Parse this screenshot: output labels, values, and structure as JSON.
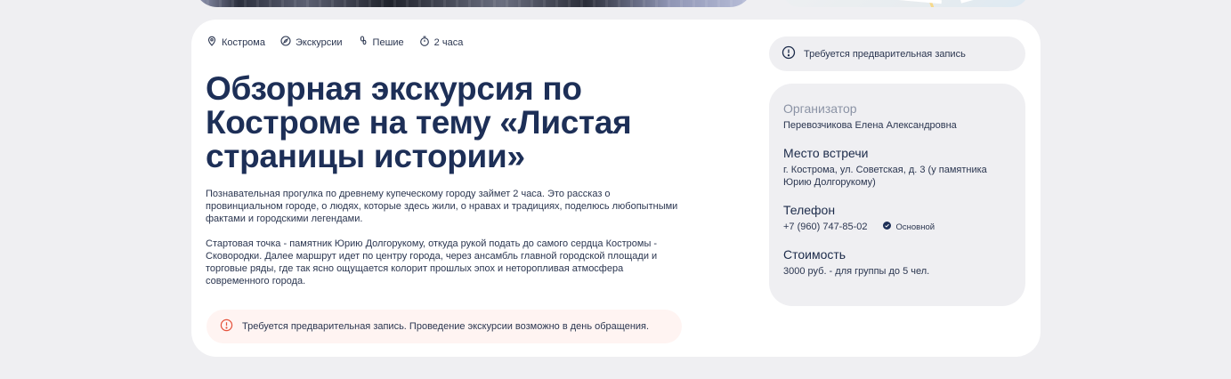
{
  "meta": {
    "city": "Кострома",
    "category": "Экскурсии",
    "mode": "Пешие",
    "duration": "2 часа"
  },
  "tour": {
    "title": "Обзорная экскурсия по Костроме на тему «Листая страницы истории»",
    "description": [
      "Познавательная прогулка по древнему купеческому городу займет 2 часа. Это рассказ о провинциальном городе, о людях, которые здесь жили, о нравах и традициях, поделюсь любопытными фактами и городскими легендами.",
      "Стартовая точка - памятник Юрию Долгорукому, откуда рукой подать до самого сердца Костромы - Сковородки. Далее маршрут идет по центру города, через ансамбль главной городской площади и торговые ряды, где так ясно ощущается колорит прошлых эпох и неторопливая атмосфера современного города."
    ],
    "notice": "Требуется предварительная запись. Проведение экскурсии возможно в день обращения."
  },
  "sidebar": {
    "notice": "Требуется предварительная запись",
    "organizer_label": "Организатор",
    "organizer_value": "Перевозчикова Елена Александровна",
    "meeting_label": "Место встречи",
    "meeting_value": "г. Кострома, ул. Советская, д. 3 (у памятника Юрию Долгорукому)",
    "phone_label": "Телефон",
    "phone_value": "+7 (960) 747-85-02",
    "phone_badge": "Основной",
    "price_label": "Стоимость",
    "price_value": "3000 руб. - для группы до 5 чел."
  },
  "colors": {
    "title": "#1d2f57",
    "background": "#efeff2",
    "notice_bg": "#fff4f2",
    "notice_icon": "#e5533d"
  },
  "icons": [
    "location-pin-icon",
    "compass-icon",
    "walking-icon",
    "stopwatch-icon",
    "warning-icon",
    "check-badge-icon"
  ]
}
